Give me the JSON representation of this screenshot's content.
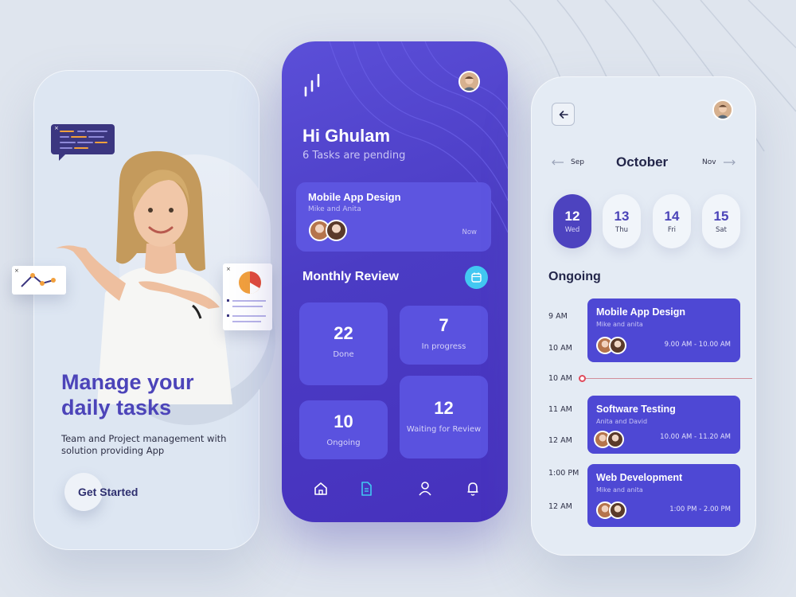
{
  "onboarding": {
    "title_line1": "Manage your",
    "title_line2": "daily tasks",
    "subtitle": "Team and Project management with solution providing App",
    "cta_label": "Get Started"
  },
  "dashboard": {
    "greeting": "Hi Ghulam",
    "pending": "6 Tasks are pending",
    "task_card": {
      "title": "Mobile App Design",
      "members": "Mike and Anita",
      "time": "Now"
    },
    "review_title": "Monthly Review",
    "stats": [
      {
        "value": "22",
        "label": "Done"
      },
      {
        "value": "7",
        "label": "In progress"
      },
      {
        "value": "10",
        "label": "Ongoing"
      },
      {
        "value": "12",
        "label": "Waiting for Review"
      }
    ]
  },
  "schedule": {
    "prev_month": "Sep",
    "current_month": "October",
    "next_month": "Nov",
    "days": [
      {
        "num": "12",
        "weekday": "Wed"
      },
      {
        "num": "13",
        "weekday": "Thu"
      },
      {
        "num": "14",
        "weekday": "Fri"
      },
      {
        "num": "15",
        "weekday": "Sat"
      }
    ],
    "section_title": "Ongoing",
    "time_labels": [
      "9 AM",
      "10 AM",
      "10 AM",
      "11 AM",
      "12 AM",
      "1:00 PM",
      "12 AM"
    ],
    "events": [
      {
        "title": "Mobile App Design",
        "members": "Mike and anita",
        "time": "9.00 AM - 10.00 AM"
      },
      {
        "title": "Software Testing",
        "members": "Anita and David",
        "time": "10.00 AM - 11.20 AM"
      },
      {
        "title": "Web Development",
        "members": "Mike and anita",
        "time": "1:00 PM - 2.00 PM"
      }
    ]
  },
  "colors": {
    "primary": "#4c44b9",
    "accent_cyan": "#42c8f2",
    "background": "#dfe5ee"
  }
}
